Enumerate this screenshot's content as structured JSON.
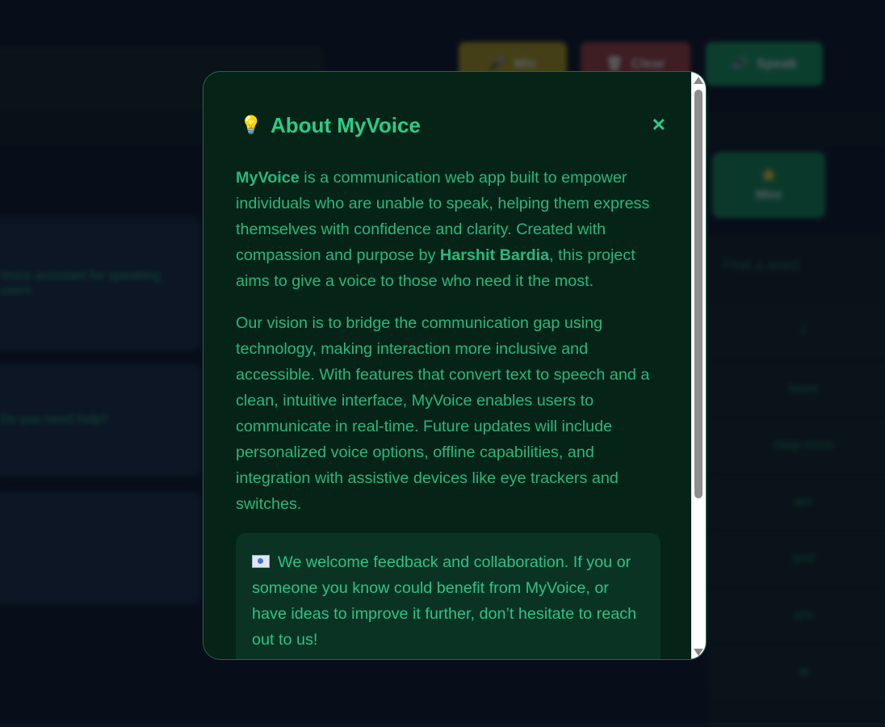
{
  "background": {
    "buttons": {
      "mic": "Mic",
      "clear": "Clear",
      "speak": "Speak"
    },
    "cards": [
      "Voice assistant for speaking users",
      "Do you need help?"
    ],
    "search_placeholder": "Find a word",
    "right_button": "Mini",
    "right_rows": [
      "I",
      "Want",
      "Help more",
      "am",
      "and",
      "are",
      "at"
    ]
  },
  "modal": {
    "title": "About MyVoice",
    "close_icon": "close-icon",
    "paragraph1": {
      "app_name": "MyVoice",
      "part1": " is a communication web app built to empower individuals who are unable to speak, helping them express themselves with confidence and clarity. Created with compassion and purpose by ",
      "author": "Harshit Bardia",
      "part2": ", this project aims to give a voice to those who need it the most."
    },
    "paragraph2": "Our vision is to bridge the communication gap using technology, making interaction more inclusive and accessible. With features that convert text to speech and a clean, intuitive interface, MyVoice enables users to communicate in real-time. Future updates will include personalized voice options, offline capabilities, and integration with assistive devices like eye trackers and switches.",
    "note": "We welcome feedback and collaboration. If you or someone you know could benefit from MyVoice, or have ideas to improve it further, don’t hesitate to reach out to us!"
  },
  "colors": {
    "accent": "#2ccc85",
    "modal_bg": "#062318",
    "page_bg": "#0b1220"
  }
}
